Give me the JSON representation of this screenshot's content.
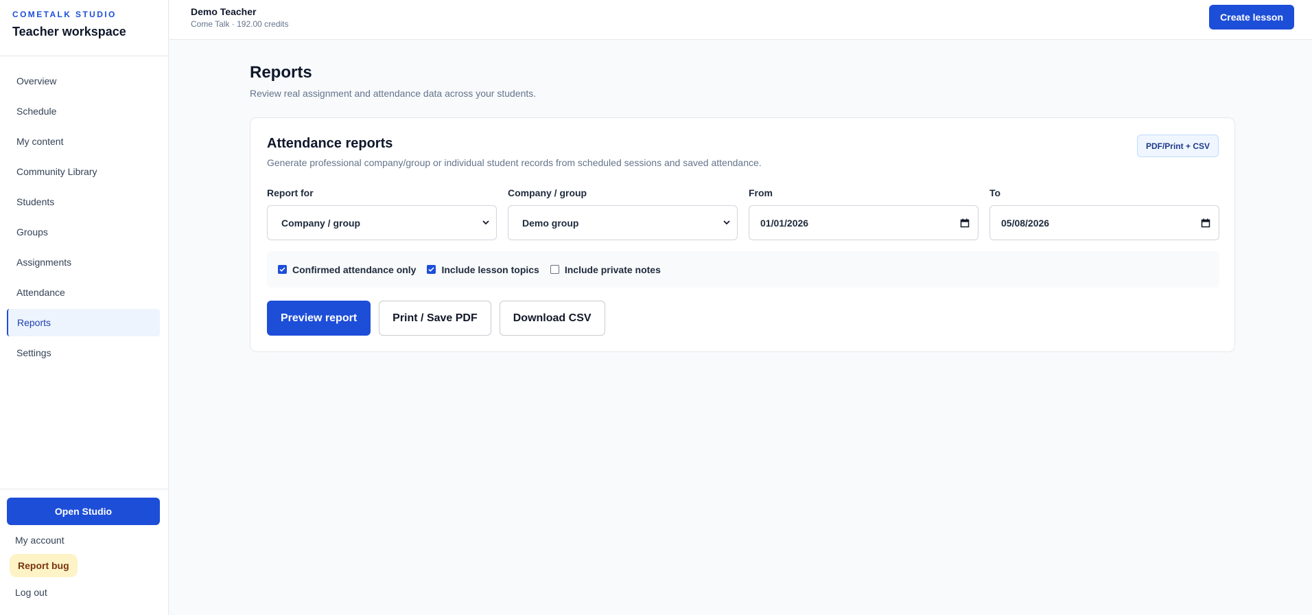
{
  "sidebar": {
    "brand_kicker": "COMETALK STUDIO",
    "brand_title": "Teacher workspace",
    "items": [
      {
        "label": "Overview",
        "active": false
      },
      {
        "label": "Schedule",
        "active": false
      },
      {
        "label": "My content",
        "active": false
      },
      {
        "label": "Community Library",
        "active": false
      },
      {
        "label": "Students",
        "active": false
      },
      {
        "label": "Groups",
        "active": false
      },
      {
        "label": "Assignments",
        "active": false
      },
      {
        "label": "Attendance",
        "active": false
      },
      {
        "label": "Reports",
        "active": true
      },
      {
        "label": "Settings",
        "active": false
      }
    ],
    "open_studio": "Open Studio",
    "my_account": "My account",
    "report_bug": "Report bug",
    "log_out": "Log out"
  },
  "topbar": {
    "user_name": "Demo Teacher",
    "user_meta": "Come Talk · 192.00 credits",
    "create_lesson": "Create lesson"
  },
  "page": {
    "title": "Reports",
    "subtitle": "Review real assignment and attendance data across your students."
  },
  "card": {
    "title": "Attendance reports",
    "subtitle": "Generate professional company/group or individual student records from scheduled sessions and saved attendance.",
    "badge": "PDF/Print + CSV",
    "fields": {
      "report_for": {
        "label": "Report for",
        "value": "Company / group"
      },
      "company_group": {
        "label": "Company / group",
        "value": "Demo group"
      },
      "from": {
        "label": "From",
        "value": "01/01/2026"
      },
      "to": {
        "label": "To",
        "value": "05/08/2026"
      }
    },
    "options": [
      {
        "label": "Confirmed attendance only",
        "checked": true
      },
      {
        "label": "Include lesson topics",
        "checked": true
      },
      {
        "label": "Include private notes",
        "checked": false
      }
    ],
    "actions": {
      "preview": "Preview report",
      "print": "Print / Save PDF",
      "csv": "Download CSV"
    }
  },
  "colors": {
    "accent": "#1d4ed8",
    "background": "#f8fafc",
    "active_nav_bg": "#eef4fe",
    "bug_bg": "#fef3c7"
  }
}
